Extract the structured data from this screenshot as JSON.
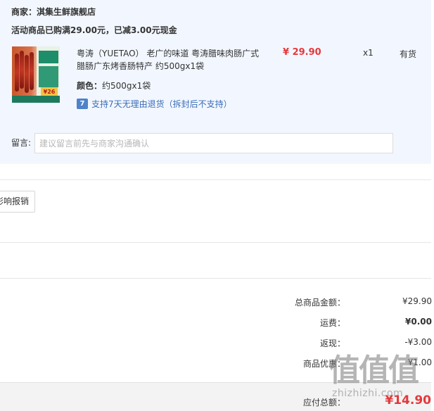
{
  "shop": {
    "merchant": "商家：淇集生鲜旗舰店",
    "promo": "活动商品已购满29.00元，已减3.00元现金"
  },
  "item": {
    "name": "粤涛（YUETAO） 老广的味道 粤涛腊味肉肠广式腊肠广东烤香肠特产 约500gx1袋",
    "price": "¥ 29.90",
    "quantity": "x1",
    "stock": "有货",
    "color_key": "颜色：",
    "color_value": "约500gx1袋",
    "return_icon_text": "7",
    "return_policy": "支持7天无理由退货（拆封后不支持）",
    "image_text": {
      "badge": "26",
      "badge_prefix": "¥"
    }
  },
  "remark": {
    "label": "留言:",
    "placeholder": "建议留言前先与商家沟通确认"
  },
  "report_button": "影响报销",
  "summary": [
    {
      "label": "总商品金额：",
      "value": "¥29.90"
    },
    {
      "label": "运费：",
      "value": "¥0.00"
    },
    {
      "label": "返现：",
      "value": "-¥3.00"
    },
    {
      "label": "商品优惠：",
      "value": "¥1.00"
    }
  ],
  "payable": {
    "label": "应付总额：",
    "value": "¥14.90"
  },
  "watermark": {
    "logo": "值值值",
    "url": "zhizhizhi.com"
  },
  "colors": {
    "panel_bg": "#f2f7ff",
    "price_red": "#e4393c",
    "link_blue": "#3b6cb8"
  }
}
